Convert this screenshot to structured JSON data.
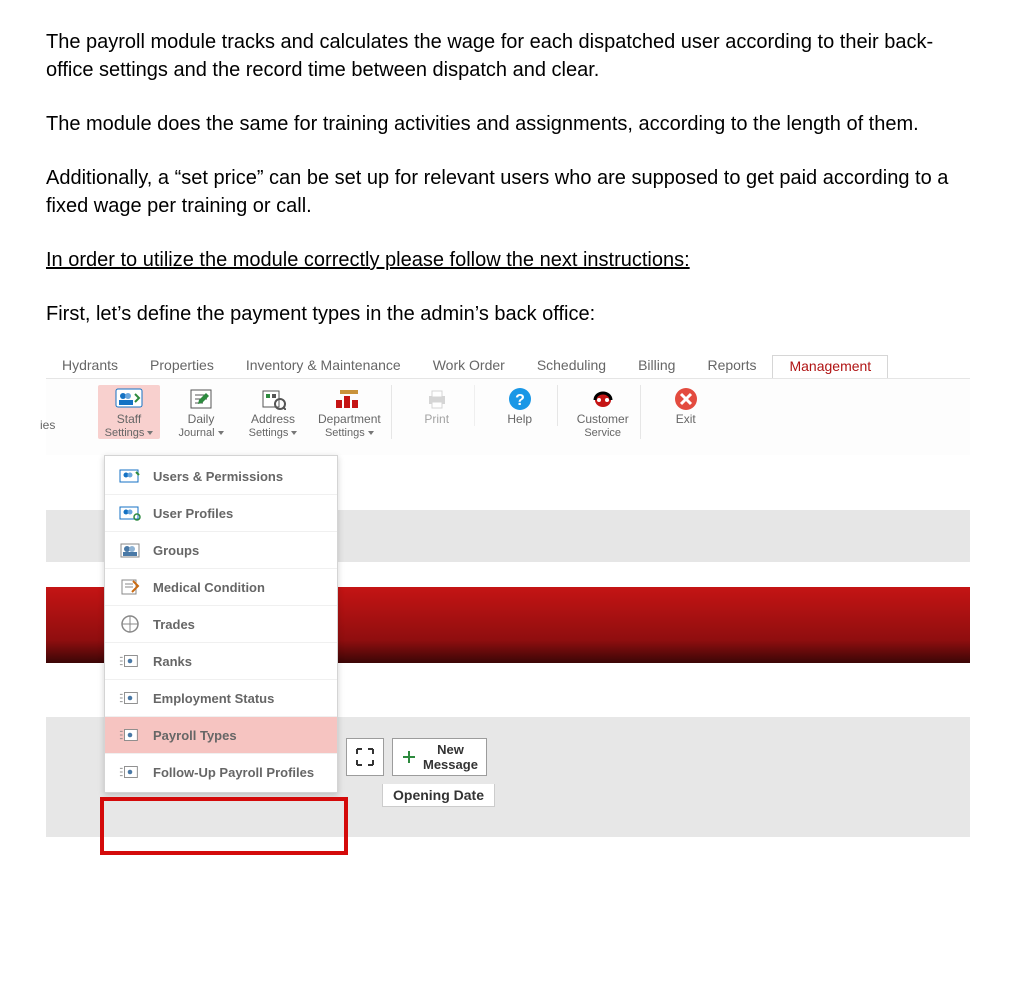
{
  "doc": {
    "p1": "The payroll module tracks and calculates the wage for each dispatched user according to their back-office settings and the record time between dispatch and clear.",
    "p2": "The module does the same for training activities and assignments, according to the length of them.",
    "p3": "Additionally, a “set price” can be set up for relevant users who are supposed to get paid according to a fixed wage per training or call.",
    "instr_line": "In order to utilize the module correctly please follow the next instructions:",
    "first_line": "First, let’s define the payment types in the admin’s back office:"
  },
  "tabs": {
    "hydrants": "Hydrants",
    "properties": "Properties",
    "inventory": "Inventory & Maintenance",
    "work_order": "Work Order",
    "scheduling": "Scheduling",
    "billing": "Billing",
    "reports": "Reports",
    "management": "Management"
  },
  "ribbon": {
    "ies_label": "ies",
    "staff_label": "Staff",
    "staff_sub": "Settings",
    "daily_label": "Daily",
    "daily_sub": "Journal",
    "address_label": "Address",
    "address_sub": "Settings",
    "department_label": "Department",
    "department_sub": "Settings",
    "print_label": "Print",
    "help_label": "Help",
    "customer_label": "Customer",
    "customer_sub": "Service",
    "exit_label": "Exit"
  },
  "dropdown": {
    "users_perms": "Users & Permissions",
    "user_profiles": "User Profiles",
    "groups": "Groups",
    "medical": "Medical Condition",
    "trades": "Trades",
    "ranks": "Ranks",
    "employment": "Employment Status",
    "payroll_types": "Payroll Types",
    "followup": "Follow-Up Payroll Profiles"
  },
  "bottom": {
    "new_label": "New",
    "message_label": "Message",
    "opening_date": "Opening Date"
  }
}
